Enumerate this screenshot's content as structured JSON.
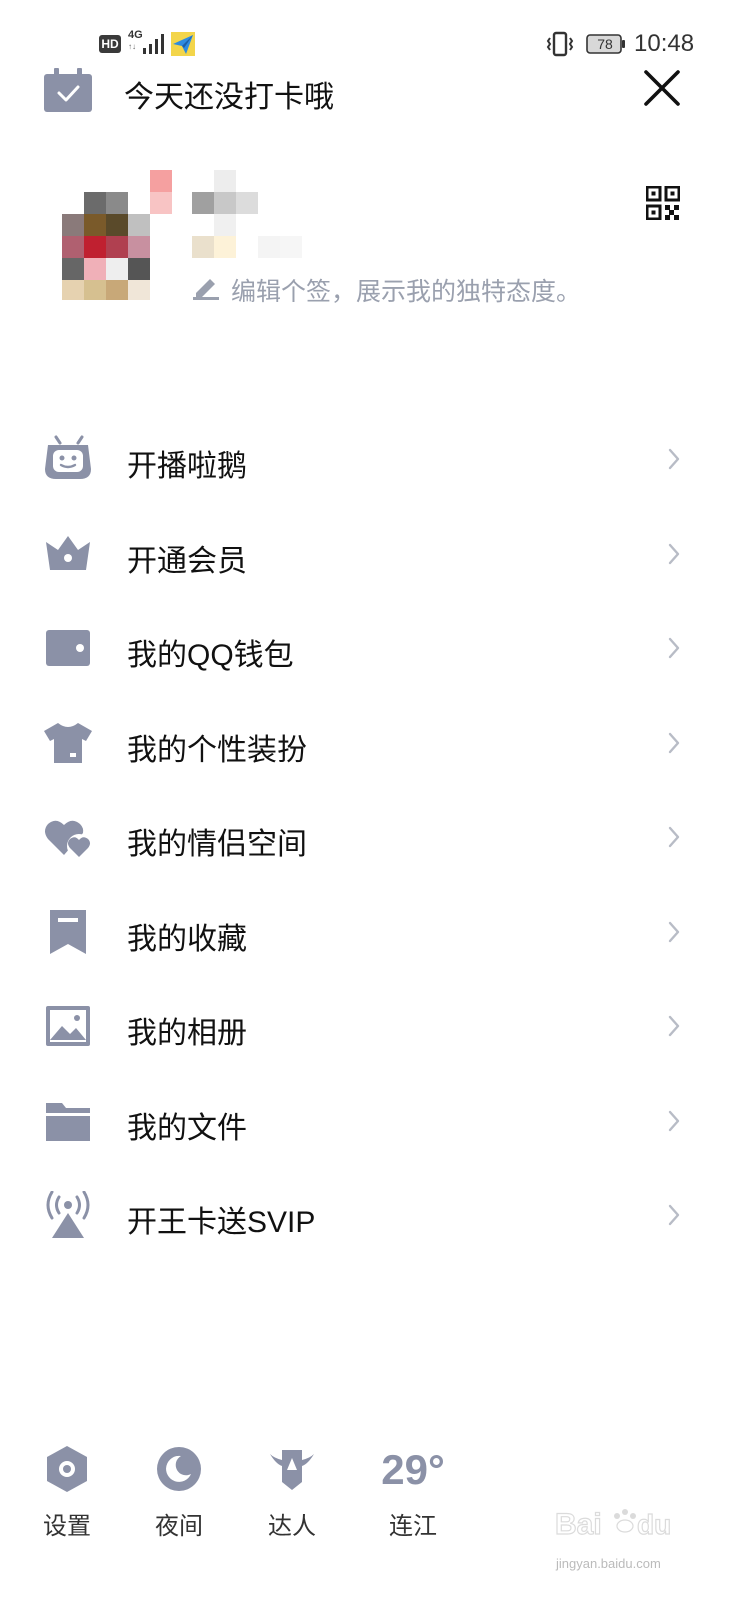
{
  "status_bar": {
    "hd": "HD",
    "network": "4G",
    "network_sub": "↑↓",
    "battery": "78",
    "time": "10:48"
  },
  "header": {
    "checkin_text": "今天还没打卡哦",
    "checkin_icon": "calendar-check-icon",
    "close_icon": "close-icon"
  },
  "profile": {
    "signature_placeholder": "编辑个签，展示我的独特态度。",
    "qr_icon": "qr-code-icon"
  },
  "menu": {
    "items": [
      {
        "label": "开播啦鹅",
        "icon": "robot-tv-icon"
      },
      {
        "label": "开通会员",
        "icon": "crown-icon"
      },
      {
        "label": "我的QQ钱包",
        "icon": "wallet-icon"
      },
      {
        "label": "我的个性装扮",
        "icon": "tshirt-icon"
      },
      {
        "label": "我的情侣空间",
        "icon": "hearts-icon"
      },
      {
        "label": "我的收藏",
        "icon": "bookmark-icon"
      },
      {
        "label": "我的相册",
        "icon": "photo-icon"
      },
      {
        "label": "我的文件",
        "icon": "folder-icon"
      },
      {
        "label": "开王卡送SVIP",
        "icon": "signal-tower-icon"
      }
    ]
  },
  "bottom_bar": {
    "settings_label": "设置",
    "night_label": "夜间",
    "expert_label": "达人",
    "temperature": "29°",
    "city": "连江"
  },
  "colors": {
    "icon_gray": "#8b91a7",
    "text_main": "#111111",
    "text_hint": "#9aa0ae",
    "chevron": "#b8bcc6"
  },
  "watermark": {
    "brand": "Baidu经验",
    "url": "jingyan.baidu.com"
  }
}
